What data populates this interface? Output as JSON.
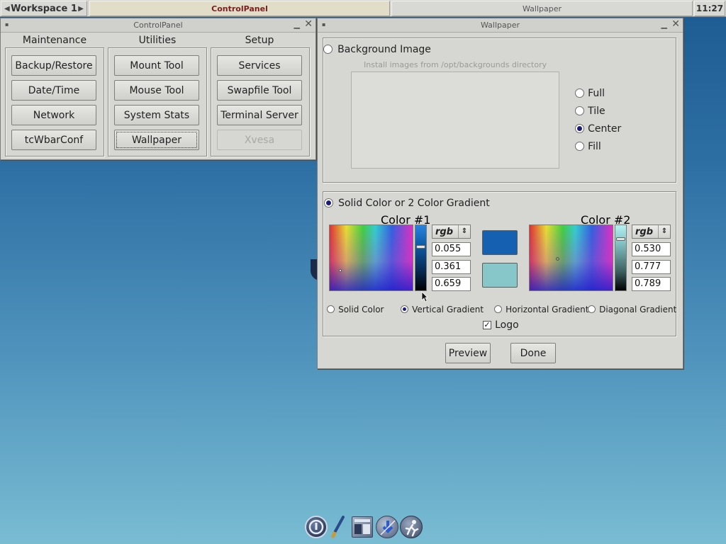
{
  "taskbar": {
    "workspace_label": "Workspace 1",
    "tasks": [
      "ControlPanel",
      "Wallpaper"
    ],
    "clock": "11:27"
  },
  "control_panel": {
    "title": "ControlPanel",
    "columns": [
      {
        "header": "Maintenance",
        "buttons": [
          "Backup/Restore",
          "Date/Time",
          "Network",
          "tcWbarConf"
        ]
      },
      {
        "header": "Utilities",
        "buttons": [
          "Mount Tool",
          "Mouse Tool",
          "System Stats",
          "Wallpaper"
        ]
      },
      {
        "header": "Setup",
        "buttons": [
          "Services",
          "Swapfile Tool",
          "Terminal Server",
          "Xvesa"
        ]
      }
    ]
  },
  "wallpaper": {
    "title": "Wallpaper",
    "bg_image_label": "Background Image",
    "install_hint": "Install images from /opt/backgrounds directory",
    "placement_options": [
      "Full",
      "Tile",
      "Center",
      "Fill"
    ],
    "placement_selected": "Center",
    "solid_label": "Solid Color or 2 Color Gradient",
    "color1": {
      "label": "Color #1",
      "mode": "rgb",
      "r": "0.055",
      "g": "0.361",
      "b": "0.659",
      "hex": "#0e5ca8"
    },
    "color2": {
      "label": "Color #2",
      "mode": "rgb",
      "r": "0.530",
      "g": "0.777",
      "b": "0.789",
      "hex": "#87c6c9"
    },
    "gradient_options": [
      "Solid Color",
      "Vertical Gradient",
      "Horizontal Gradient",
      "Diagonal Gradient"
    ],
    "gradient_selected": "Vertical Gradient",
    "logo_label": "Logo",
    "logo_checked": true,
    "preview_label": "Preview",
    "done_label": "Done"
  },
  "dock": {
    "icons": [
      "power-icon",
      "paintbrush-icon",
      "control-panel-icon",
      "install-icon",
      "running-man-icon"
    ]
  }
}
